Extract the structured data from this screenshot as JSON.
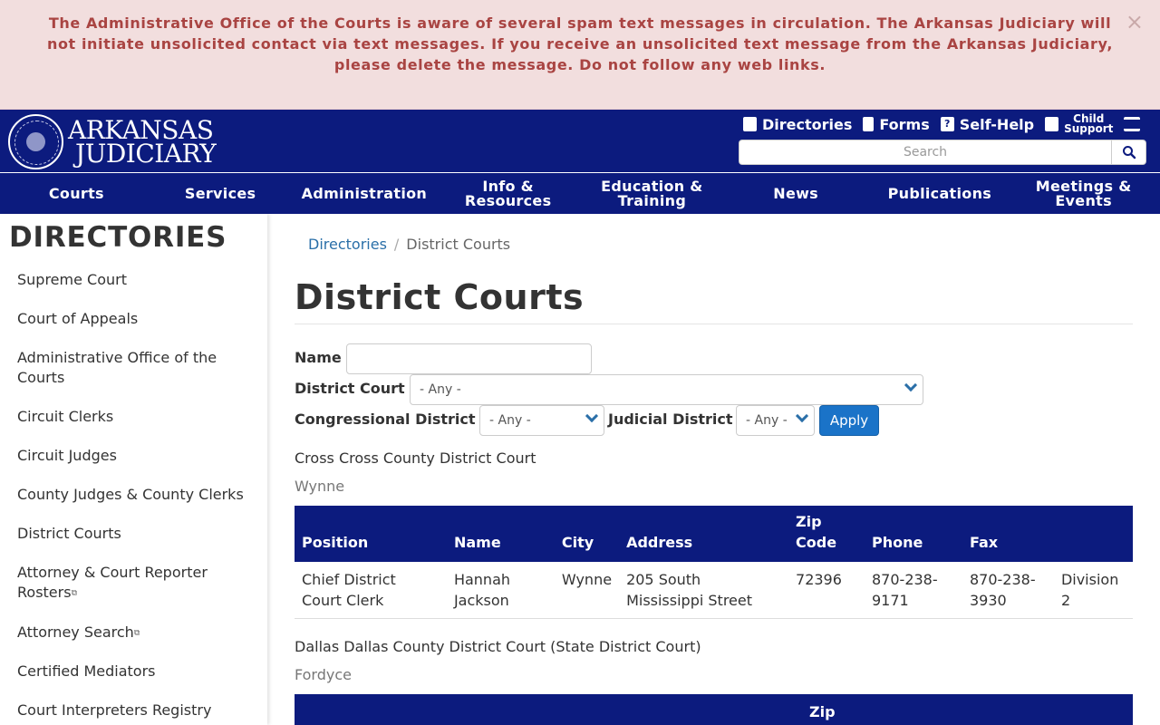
{
  "alert": {
    "message": "The Administrative Office of the Courts is aware of several spam text messages in circulation.  The Arkansas Judiciary will not initiate unsolicited contact via text messages. If you receive an unsolicited text message from the Arkansas Judiciary, please delete the message. Do not follow any web links.",
    "close": "×"
  },
  "header": {
    "logo_line1": "ARKANSAS",
    "logo_line2": "JUDICIARY",
    "utility": [
      "Directories",
      "Forms",
      "Self-Help"
    ],
    "child_support_line1": "Child",
    "child_support_line2": "Support",
    "search_placeholder": "Search"
  },
  "nav": [
    "Courts",
    "Services",
    "Administration",
    "Info &\nResources",
    "Education &\nTraining",
    "News",
    "Publications",
    "Meetings &\nEvents"
  ],
  "sidebar": {
    "title": "DIRECTORIES",
    "items": [
      "Supreme Court",
      "Court of Appeals",
      "Administrative Office of the Courts",
      "Circuit Clerks",
      "Circuit Judges",
      "County Judges & County Clerks",
      "District Courts",
      "Attorney & Court Reporter Rosters",
      "Attorney Search",
      "Certified Mediators",
      "Court Interpreters Registry"
    ]
  },
  "breadcrumb": {
    "parent": "Directories",
    "current": "District Courts",
    "separator": "/"
  },
  "page_title": "District Courts",
  "filters": {
    "name_label": "Name",
    "name_value": "",
    "district_court_label": "District Court",
    "district_court_value": "- Any -",
    "congressional_label": "Congressional District",
    "congressional_value": "- Any -",
    "judicial_label": "Judicial District",
    "judicial_value": "- Any -",
    "apply_label": "Apply"
  },
  "courts": [
    {
      "name": "Cross Cross County District Court",
      "city": "Wynne",
      "headers": [
        "Position",
        "Name",
        "City",
        "Address",
        "Zip Code",
        "Phone",
        "Fax",
        ""
      ],
      "rows": [
        [
          "Chief District Court Clerk",
          "Hannah Jackson",
          "Wynne",
          "205 South Mississippi Street",
          "72396",
          "870-238-9171",
          "870-238-3930",
          "Division 2"
        ]
      ]
    },
    {
      "name": "Dallas Dallas County District Court (State District Court)",
      "city": "Fordyce",
      "headers_visible": "Zip"
    }
  ]
}
